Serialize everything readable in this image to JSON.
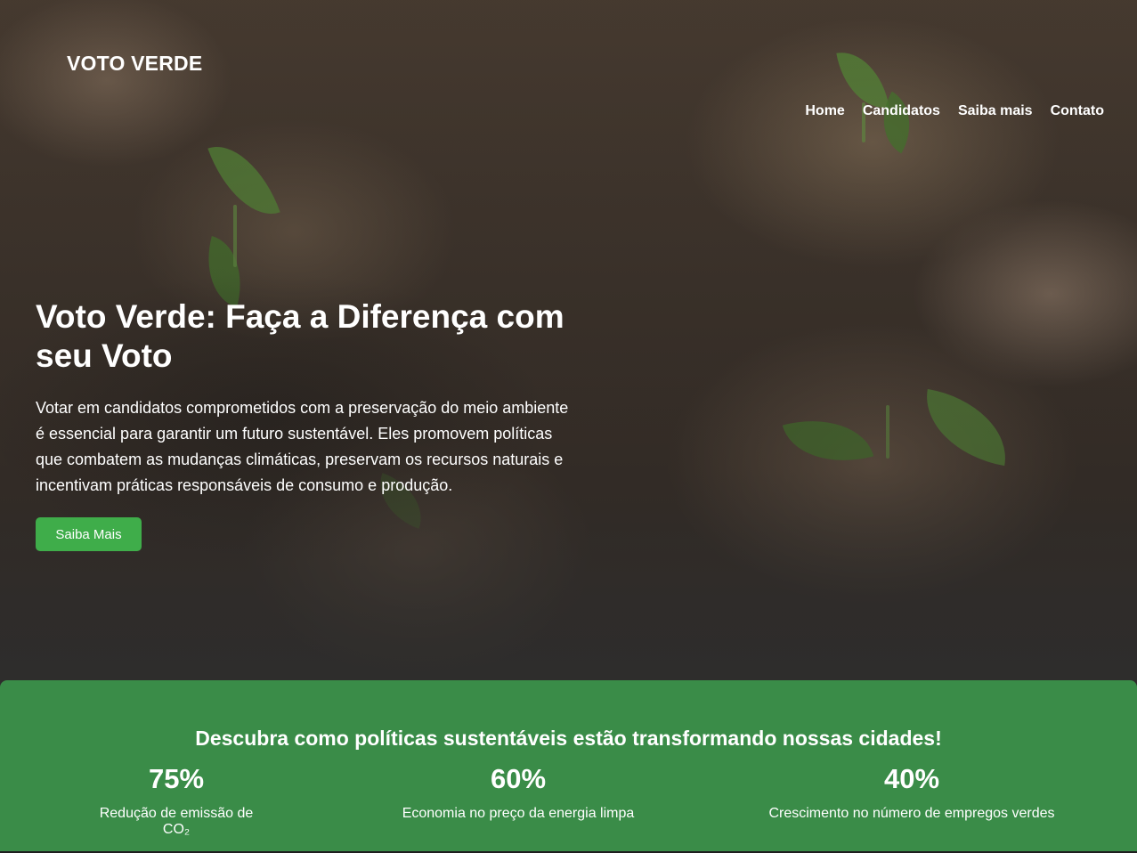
{
  "header": {
    "logo": "VOTO VERDE",
    "nav": [
      {
        "label": "Home"
      },
      {
        "label": "Candidatos"
      },
      {
        "label": "Saiba mais"
      },
      {
        "label": "Contato"
      }
    ]
  },
  "hero": {
    "title": "Voto Verde: Faça a Diferença com seu Voto",
    "text": "Votar em candidatos comprometidos com a preservação do meio ambiente é essencial para garantir um futuro sustentável. Eles promovem políticas que combatem as mudanças climáticas, preservam os recursos naturais e incentivam práticas responsáveis de consumo e produção.",
    "cta_label": "Saiba Mais"
  },
  "stats": {
    "title": "Descubra como políticas sustentáveis estão transformando nossas cidades!",
    "items": [
      {
        "value": "75%",
        "label": "Redução de emissão de CO₂"
      },
      {
        "value": "60%",
        "label": "Economia no preço da energia limpa"
      },
      {
        "value": "40%",
        "label": "Crescimento no número de empregos verdes"
      }
    ]
  },
  "colors": {
    "accent_green": "#3fad4a",
    "section_green": "#3a8c48",
    "text": "#ffffff"
  }
}
